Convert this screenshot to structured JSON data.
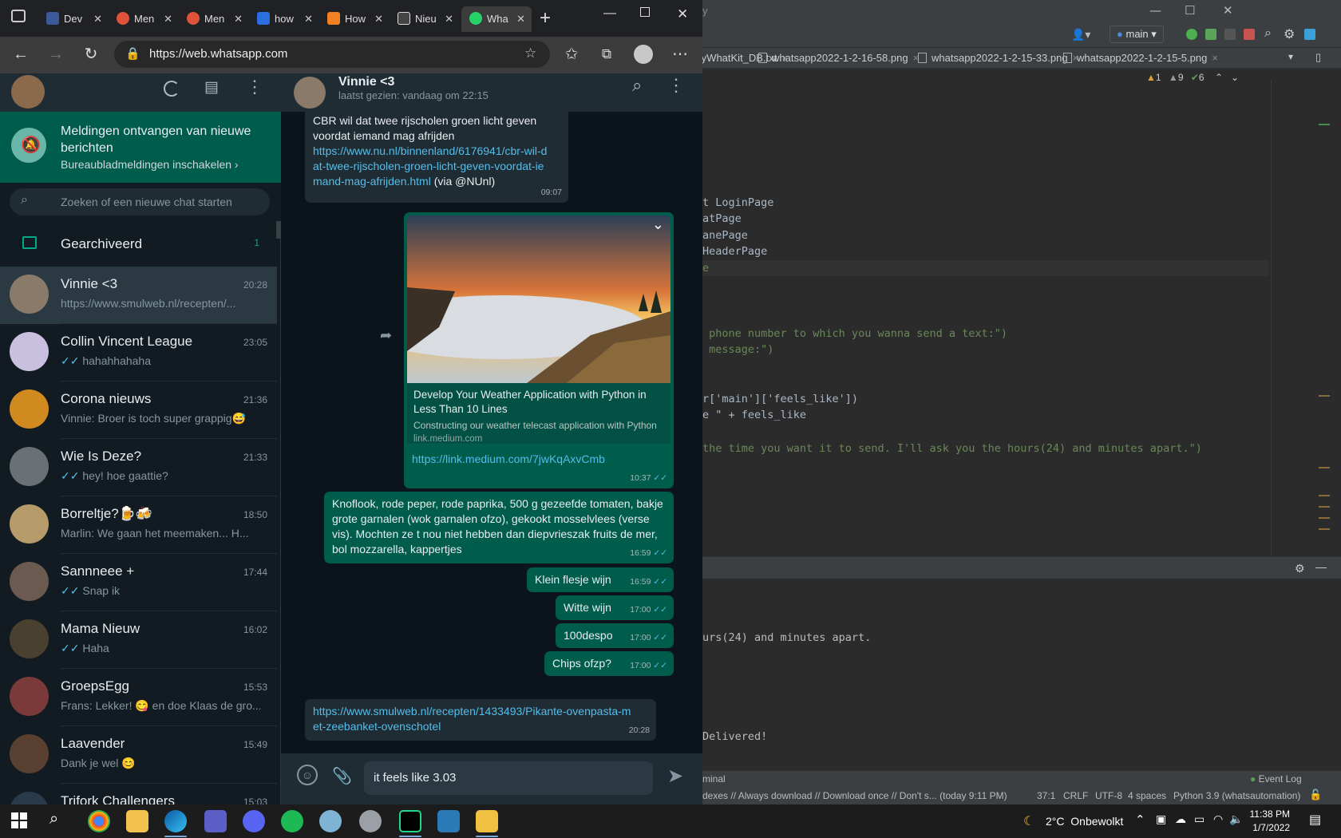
{
  "browser": {
    "tabs": [
      {
        "label": "Dev",
        "color": "#3b5998"
      },
      {
        "label": "Men",
        "color": "#e0533b"
      },
      {
        "label": "Men",
        "color": "#e0533b"
      },
      {
        "label": "how",
        "color": "#2a6fe0"
      },
      {
        "label": "How",
        "color": "#f48024"
      },
      {
        "label": "Nieu",
        "color": "#444444"
      },
      {
        "label": "Wha",
        "color": "#25d366"
      }
    ],
    "url": "https://web.whatsapp.com"
  },
  "whatsapp": {
    "notification": {
      "title": "Meldingen ontvangen van nieuwe berichten",
      "link": "Bureaubladmeldingen inschakelen ›"
    },
    "search_placeholder": "Zoeken of een nieuwe chat starten",
    "archived": {
      "label": "Gearchiveerd",
      "count": "1"
    },
    "chats": [
      {
        "name": "Vinnie <3",
        "time": "20:28",
        "msg": "https://www.smulweb.nl/recepten/...",
        "ticks": "",
        "color": "#8a7a6a"
      },
      {
        "name": "Collin Vincent League",
        "time": "23:05",
        "msg": "hahahhahaha",
        "ticks": "✓✓",
        "color": "#c9c0e0"
      },
      {
        "name": "Corona nieuws",
        "time": "21:36",
        "msg": "Vinnie: Broer is toch super grappig😅",
        "ticks": "",
        "color": "#d08a20"
      },
      {
        "name": "Wie Is Deze?",
        "time": "21:33",
        "msg": "hey! hoe gaattie?",
        "ticks": "✓✓",
        "color": "#6a7175"
      },
      {
        "name": "Borreltje?🍺🍻",
        "time": "18:50",
        "msg": "Marlin: We gaan het meemaken... H...",
        "ticks": "",
        "color": "#b59a6a"
      },
      {
        "name": "Sannneee +",
        "time": "17:44",
        "msg": "Snap ik",
        "ticks": "✓✓",
        "color": "#6a5a50"
      },
      {
        "name": "Mama Nieuw",
        "time": "16:02",
        "msg": "Haha",
        "ticks": "✓✓",
        "color": "#4a4030"
      },
      {
        "name": "GroepsEgg",
        "time": "15:53",
        "msg": "Frans: Lekker! 😋 en doe Klaas de gro...",
        "ticks": "",
        "color": "#7a3a3a"
      },
      {
        "name": "Laavender",
        "time": "15:49",
        "msg": "Dank je wel 😊",
        "ticks": "",
        "color": "#5a4030"
      },
      {
        "name": "Trifork Challengers",
        "time": "15:03",
        "msg": "",
        "ticks": "",
        "color": "#2a3a4a"
      }
    ],
    "contact": {
      "name": "Vinnie <3",
      "status": "laatst gezien: vandaag om 22:15"
    },
    "messages": {
      "m1_text": "CBR wil dat twee rijscholen groen licht geven voordat iemand mag afrijden",
      "m1_link": "https://www.nu.nl/binnenland/6176941/cbr-wil-dat-twee-rijscholen-groen-licht-geven-voordat-iemand-mag-afrijden.html",
      "m1_via": "(via @NUnl)",
      "m1_time": "09:07",
      "m2_title": "Develop Your Weather Application with Python in Less Than 10 Lines",
      "m2_desc": "Constructing our weather telecast application with Python",
      "m2_domain": "link.medium.com",
      "m2_link": "https://link.medium.com/7jwKqAxvCmb",
      "m2_time": "10:37",
      "m3_text": "Knoflook, rode peper, rode paprika, 500 g gezeefde tomaten, bakje grote garnalen (wok garnalen ofzo), gekookt mosselvlees (verse vis). Mochten ze t nou niet hebben dan diepvrieszak fruits de mer, bol mozzarella, kappertjes",
      "m3_time": "16:59",
      "m4_text": "Klein flesje wijn",
      "m4_time": "16:59",
      "m5_text": "Witte wijn",
      "m5_time": "17:00",
      "m6_text": "100despo",
      "m6_time": "17:00",
      "m7_text": "Chips ofzp?",
      "m7_time": "17:00",
      "m8_link": "https://www.smulweb.nl/recepten/1433493/Pikante-ovenpasta-met-zeebanket-ovenschotel",
      "m8_time": "20:28"
    },
    "compose_text": "it feels like 3.03"
  },
  "ide": {
    "title_fragment": "y",
    "branch": "main",
    "tabs": [
      "PyWhatKit_DB.txt",
      "whatsapp2022-1-2-16-58.png",
      "whatsapp2022-1-2-15-33.png",
      "whatsapp2022-1-2-15-5.png"
    ],
    "inspections": {
      "warn": "1",
      "weak": "9",
      "ok": "6"
    },
    "code_lines": [
      {
        "t": "t LoginPage"
      },
      {
        "t": "atPage"
      },
      {
        "t": "anePage"
      },
      {
        "t": "HeaderPage"
      },
      {
        "t": "e"
      },
      {
        "t": " phone number to which you wanna send a text:\")"
      },
      {
        "t": " message:\")"
      },
      {
        "t": "r['main']['feels_like'])"
      },
      {
        "t": "e \" + feels_like"
      },
      {
        "t": "the time you want it to send. I'll ask you the hours(24) and minutes apart.\")"
      }
    ],
    "run_output": [
      "urs(24) and minutes apart.",
      "Delivered!"
    ],
    "tool_label": "minal",
    "event_log": "Event Log",
    "status_msg": "dexes // Always download // Download once // Don't s... (today 9:11 PM)",
    "status": [
      "37:1",
      "CRLF",
      "UTF-8",
      "4 spaces",
      "Python 3.9 (whatsautomation)"
    ]
  },
  "taskbar": {
    "weather": "2°C  Onbewolkt",
    "time": "11:38 PM",
    "date": "1/7/2022"
  }
}
